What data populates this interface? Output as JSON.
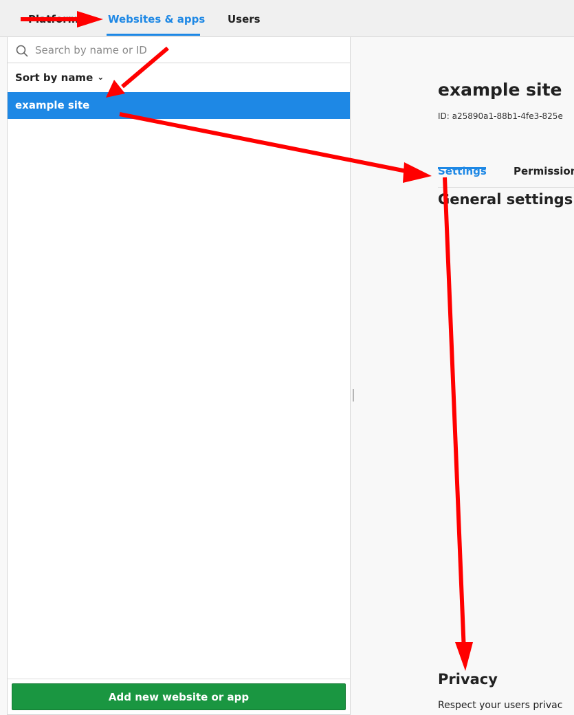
{
  "nav": {
    "tabs": [
      {
        "label": "Platform"
      },
      {
        "label": "Websites & apps"
      },
      {
        "label": "Users"
      }
    ]
  },
  "sidebar": {
    "search_placeholder": "Search by name or ID",
    "sort_label": "Sort by name",
    "items": [
      {
        "label": "example site"
      }
    ],
    "add_button_label": "Add new website or app"
  },
  "detail": {
    "title": "example site",
    "id_text": "ID: a25890a1-88b1-4fe3-825e",
    "tabs": [
      {
        "label": "Settings"
      },
      {
        "label": "Permission"
      }
    ],
    "general_title": "General settings",
    "privacy_title": "Privacy",
    "privacy_desc": "Respect your users privac"
  },
  "colors": {
    "accent": "#1e88e5",
    "button_green": "#1a9641",
    "arrow_red": "#ff0000"
  },
  "icons": [
    "search-icon",
    "chevron-down-icon"
  ]
}
